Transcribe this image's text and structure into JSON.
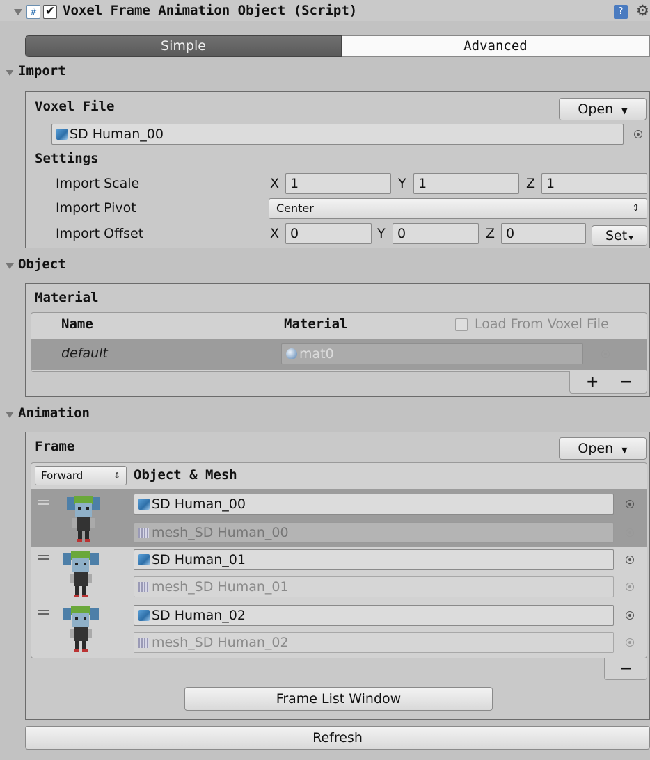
{
  "header": {
    "title": "Voxel Frame Animation Object (Script)",
    "enabled": true
  },
  "mode_tabs": [
    {
      "label": "Simple",
      "selected": true
    },
    {
      "label": "Advanced",
      "selected": false
    }
  ],
  "import_section": {
    "title": "Import",
    "voxel_file_label": "Voxel File",
    "open_label": "Open",
    "voxel_file_value": "SD Human_00",
    "settings_label": "Settings",
    "scale": {
      "label": "Import Scale",
      "x": "1",
      "y": "1",
      "z": "1"
    },
    "pivot": {
      "label": "Import Pivot",
      "value": "Center"
    },
    "offset": {
      "label": "Import Offset",
      "x": "0",
      "y": "0",
      "z": "0",
      "set_label": "Set"
    },
    "axes": {
      "x": "X",
      "y": "Y",
      "z": "Z"
    }
  },
  "object_section": {
    "title": "Object",
    "material_label": "Material",
    "col_name": "Name",
    "col_material": "Material",
    "load_from_voxel_label": "Load From Voxel File",
    "load_from_voxel_checked": false,
    "rows": [
      {
        "name": "default",
        "material": "mat0"
      }
    ],
    "add_label": "+",
    "remove_label": "−"
  },
  "animation_section": {
    "title": "Animation",
    "frame_label": "Frame",
    "open_label": "Open",
    "direction": "Forward",
    "col_object_mesh": "Object & Mesh",
    "frames": [
      {
        "object": "SD Human_00",
        "mesh": "mesh_SD Human_00",
        "selected": true
      },
      {
        "object": "SD Human_01",
        "mesh": "mesh_SD Human_01",
        "selected": false
      },
      {
        "object": "SD Human_02",
        "mesh": "mesh_SD Human_02",
        "selected": false
      }
    ],
    "remove_label": "−",
    "frame_list_button": "Frame List Window"
  },
  "refresh_button": "Refresh",
  "icons": {
    "help": "help-icon",
    "settings": "gear-icon",
    "script": "script-icon"
  }
}
